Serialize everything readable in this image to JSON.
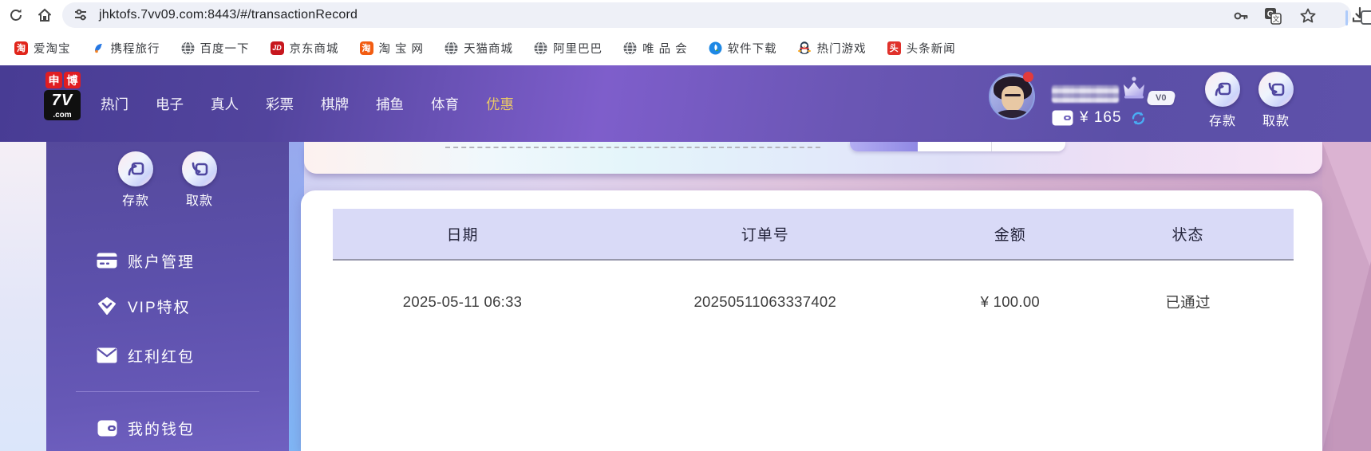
{
  "browser": {
    "url": "jhktofs.7vv09.com:8443/#/transactionRecord",
    "bookmarks": [
      {
        "label": "爱淘宝",
        "icon": "taobao-red",
        "glyph": "淘"
      },
      {
        "label": "携程旅行",
        "icon": "ctrip-dolphin",
        "glyph": ""
      },
      {
        "label": "百度一下",
        "icon": "globe",
        "glyph": ""
      },
      {
        "label": "京东商城",
        "icon": "jd",
        "glyph": "JD"
      },
      {
        "label": "淘 宝 网",
        "icon": "taobao-orange",
        "glyph": "淘"
      },
      {
        "label": "天猫商城",
        "icon": "globe",
        "glyph": ""
      },
      {
        "label": "阿里巴巴",
        "icon": "globe",
        "glyph": ""
      },
      {
        "label": "唯 品 会",
        "icon": "globe",
        "glyph": ""
      },
      {
        "label": "软件下载",
        "icon": "software",
        "glyph": ""
      },
      {
        "label": "热门游戏",
        "icon": "qq-penguin",
        "glyph": ""
      },
      {
        "label": "头条新闻",
        "icon": "toutiao",
        "glyph": "头"
      }
    ]
  },
  "site_header": {
    "logo": {
      "char1": "申",
      "char2": "博",
      "line2": "7V",
      "line3": ".com"
    },
    "nav": [
      {
        "label": "热门"
      },
      {
        "label": "电子"
      },
      {
        "label": "真人"
      },
      {
        "label": "彩票"
      },
      {
        "label": "棋牌"
      },
      {
        "label": "捕鱼"
      },
      {
        "label": "体育"
      },
      {
        "label": "优惠"
      }
    ],
    "user": {
      "vip_badge": "V0",
      "balance": "¥ 165"
    },
    "actions": {
      "deposit": "存款",
      "withdraw": "取款"
    }
  },
  "sidebar": {
    "deposit": "存款",
    "withdraw": "取款",
    "menu": [
      {
        "label": "账户管理"
      },
      {
        "label": "VIP特权"
      },
      {
        "label": "红利红包"
      },
      {
        "label": "我的钱包"
      }
    ]
  },
  "main": {
    "table": {
      "headers": [
        "日期",
        "订单号",
        "金额",
        "状态"
      ],
      "rows": [
        [
          "2025-05-11 06:33",
          "20250511063337402",
          "¥ 100.00",
          "已通过"
        ]
      ]
    }
  },
  "colors": {
    "header_purple": "#5b4fa7",
    "sidebar_purple": "#5c50ab",
    "brand_red": "#e01d22",
    "nav_active_gold": "#e9c867",
    "table_header_lavender": "#d9daf7",
    "refresh_blue": "#49aef5",
    "status_text": "#3c3c3c"
  }
}
